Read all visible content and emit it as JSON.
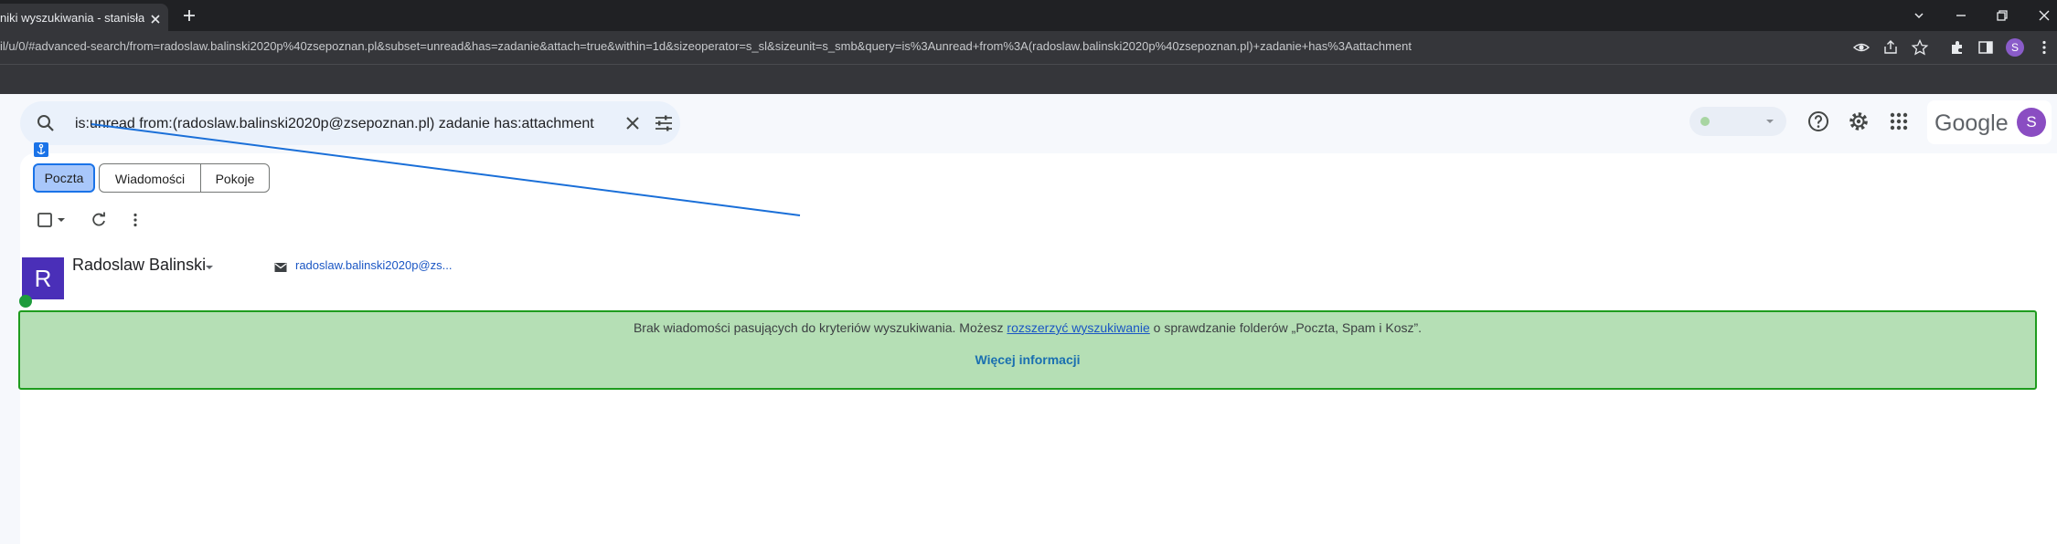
{
  "browser": {
    "tab_title": "niki wyszukiwania - stanisław",
    "url": "il/u/0/#advanced-search/from=radoslaw.balinski2020p%40zsepoznan.pl&subset=unread&has=zadanie&attach=true&within=1d&sizeoperator=s_sl&sizeunit=s_smb&query=is%3Aunread+from%3A(radoslaw.balinski2020p%40zsepoznan.pl)+zadanie+has%3Aattachment",
    "profile_initial": "S"
  },
  "search": {
    "query": "is:unread from:(radoslaw.balinski2020p@zsepoznan.pl) zadanie has:attachment"
  },
  "header": {
    "logo_text": "Google",
    "account_initial": "S"
  },
  "chips": [
    "Poczta",
    "Wiadomości",
    "Pokoje"
  ],
  "sender": {
    "initial": "R",
    "name": "Radoslaw Balinski",
    "email": "radoslaw.balinski2020p@zs..."
  },
  "no_results": {
    "text_before": "Brak wiadomości pasujących do kryteriów wyszukiwania. Możesz ",
    "link_text": "rozszerzyć wyszukiwanie",
    "text_after": " o sprawdzanie folderów „Poczta, Spam i Kosz”.",
    "more_link": "Więcej informacji"
  },
  "colors": {
    "accent": "#1a73e8",
    "no_results_bg": "#b5dfb5",
    "no_results_border": "#1e9c1e",
    "sender_avatar": "#4a2fb8"
  }
}
